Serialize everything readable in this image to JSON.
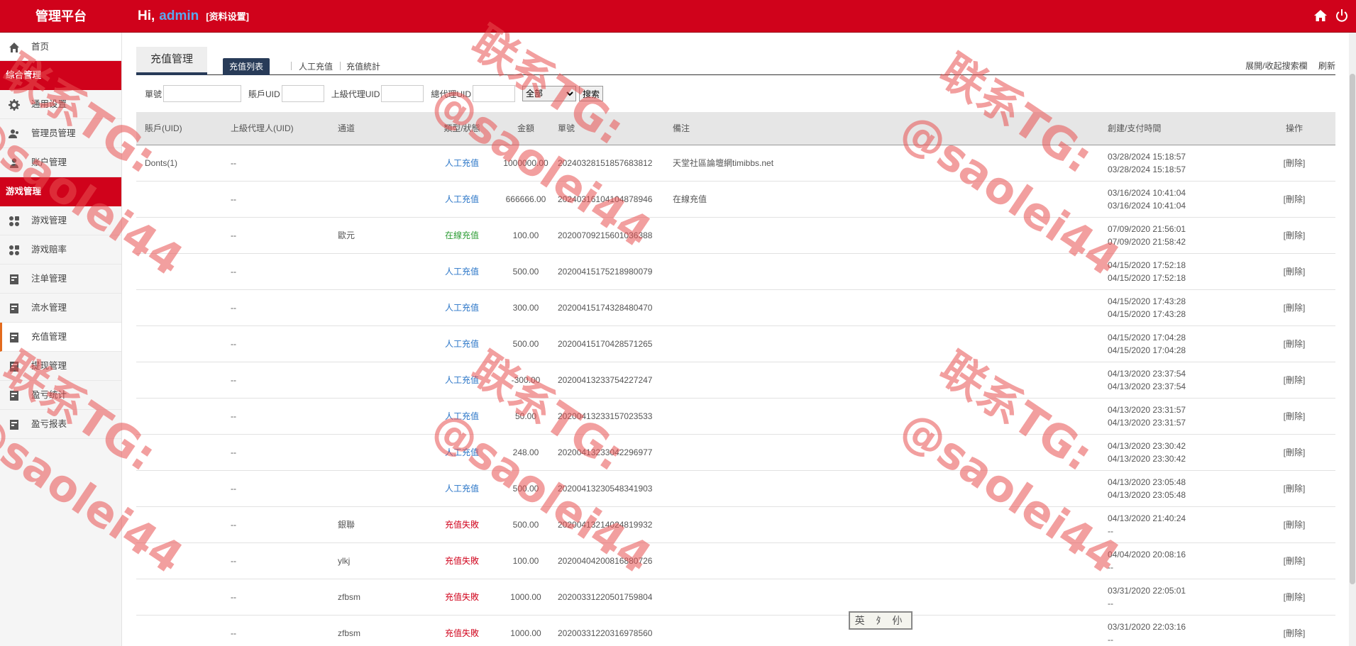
{
  "header": {
    "brand": "管理平台",
    "greeting": "Hi,",
    "username": "admin",
    "profile_link": "[资料设置]",
    "icons": [
      "home-icon",
      "power-icon"
    ]
  },
  "sidebar": {
    "home": "首页",
    "group1": "综合管理",
    "group1_items": [
      "通用设置",
      "管理员管理",
      "账户管理"
    ],
    "group2": "游戏管理",
    "group2_items": [
      "游戏管理",
      "游戏赔率",
      "注单管理",
      "流水管理",
      "充值管理",
      "提现管理",
      "盈亏统计",
      "盈亏报表"
    ],
    "active_item": "充值管理"
  },
  "main": {
    "page_tab": "充值管理",
    "subtabs": [
      "充值列表",
      "人工充值",
      "充值統計"
    ],
    "actions": [
      "展開/收起搜索欄",
      "刷新"
    ]
  },
  "search": {
    "order_label": "單號",
    "account_label": "賬戶UID",
    "parent_label": "上級代理UID",
    "general_label": "總代理UID",
    "select_value": "全部",
    "button": "搜索"
  },
  "table": {
    "headers": [
      "賬戶(UID)",
      "上級代理人(UID)",
      "通道",
      "類型/狀態",
      "金額",
      "單號",
      "備注",
      "創建/支付時間",
      "操作"
    ],
    "rows": [
      {
        "account": "Donts(1)",
        "parent": "--",
        "channel": "",
        "type": "人工充值",
        "type_color": "blue",
        "amount": "1000000.00",
        "order": "20240328151857683812",
        "remark": "天堂社區論壇網timibbs.net",
        "created": "03/28/2024 15:18:57",
        "paid": "03/28/2024 15:18:57",
        "op": "[刪除]"
      },
      {
        "account": "",
        "parent": "--",
        "channel": "",
        "type": "人工充值",
        "type_color": "blue",
        "amount": "666666.00",
        "order": "20240316104104878946",
        "remark": "在線充值",
        "created": "03/16/2024 10:41:04",
        "paid": "03/16/2024 10:41:04",
        "op": "[刪除]"
      },
      {
        "account": "",
        "parent": "--",
        "channel": "歐元",
        "type": "在線充值",
        "type_color": "green",
        "amount": "100.00",
        "order": "20200709215601036388",
        "remark": "",
        "created": "07/09/2020 21:56:01",
        "paid": "07/09/2020 21:58:42",
        "op": "[刪除]"
      },
      {
        "account": "",
        "parent": "--",
        "channel": "",
        "type": "人工充值",
        "type_color": "blue",
        "amount": "500.00",
        "order": "20200415175218980079",
        "remark": "",
        "created": "04/15/2020 17:52:18",
        "paid": "04/15/2020 17:52:18",
        "op": "[刪除]"
      },
      {
        "account": "",
        "parent": "--",
        "channel": "",
        "type": "人工充值",
        "type_color": "blue",
        "amount": "300.00",
        "order": "20200415174328480470",
        "remark": "",
        "created": "04/15/2020 17:43:28",
        "paid": "04/15/2020 17:43:28",
        "op": "[刪除]"
      },
      {
        "account": "",
        "parent": "--",
        "channel": "",
        "type": "人工充值",
        "type_color": "blue",
        "amount": "500.00",
        "order": "20200415170428571265",
        "remark": "",
        "created": "04/15/2020 17:04:28",
        "paid": "04/15/2020 17:04:28",
        "op": "[刪除]"
      },
      {
        "account": "",
        "parent": "--",
        "channel": "",
        "type": "人工充值",
        "type_color": "blue",
        "amount": "-300.00",
        "order": "20200413233754227247",
        "remark": "",
        "created": "04/13/2020 23:37:54",
        "paid": "04/13/2020 23:37:54",
        "op": "[刪除]"
      },
      {
        "account": "",
        "parent": "--",
        "channel": "",
        "type": "人工充值",
        "type_color": "blue",
        "amount": "50.00",
        "order": "20200413233157023533",
        "remark": "",
        "created": "04/13/2020 23:31:57",
        "paid": "04/13/2020 23:31:57",
        "op": "[刪除]"
      },
      {
        "account": "",
        "parent": "--",
        "channel": "",
        "type": "人工充值",
        "type_color": "blue",
        "amount": "248.00",
        "order": "20200413233042296977",
        "remark": "",
        "created": "04/13/2020 23:30:42",
        "paid": "04/13/2020 23:30:42",
        "op": "[刪除]"
      },
      {
        "account": "",
        "parent": "--",
        "channel": "",
        "type": "人工充值",
        "type_color": "blue",
        "amount": "500.00",
        "order": "20200413230548341903",
        "remark": "",
        "created": "04/13/2020 23:05:48",
        "paid": "04/13/2020 23:05:48",
        "op": "[刪除]"
      },
      {
        "account": "",
        "parent": "--",
        "channel": "銀聯",
        "type": "充值失敗",
        "type_color": "red",
        "amount": "500.00",
        "order": "20200413214024819932",
        "remark": "",
        "created": "04/13/2020 21:40:24",
        "paid": "--",
        "op": "[刪除]"
      },
      {
        "account": "",
        "parent": "--",
        "channel": "ylkj",
        "type": "充值失敗",
        "type_color": "red",
        "amount": "100.00",
        "order": "20200404200816880726",
        "remark": "",
        "created": "04/04/2020 20:08:16",
        "paid": "--",
        "op": "[刪除]"
      },
      {
        "account": "",
        "parent": "--",
        "channel": "zfbsm",
        "type": "充值失敗",
        "type_color": "red",
        "amount": "1000.00",
        "order": "20200331220501759804",
        "remark": "",
        "created": "03/31/2020 22:05:01",
        "paid": "--",
        "op": "[刪除]"
      },
      {
        "account": "",
        "parent": "--",
        "channel": "zfbsm",
        "type": "充值失敗",
        "type_color": "red",
        "amount": "1000.00",
        "order": "20200331220316978560",
        "remark": "",
        "created": "03/31/2020 22:03:16",
        "paid": "--",
        "op": "[刪除]"
      }
    ]
  },
  "watermark": {
    "line1": "联系TG:",
    "line2": "@saolei44"
  },
  "ime": "英 ﾀ 仦",
  "colors": {
    "header_red": "#d0021b",
    "tab_navy": "#283b58",
    "active_orange": "#e36b1e",
    "link_blue": "#2a75c7",
    "online_green": "#2e9d36"
  }
}
